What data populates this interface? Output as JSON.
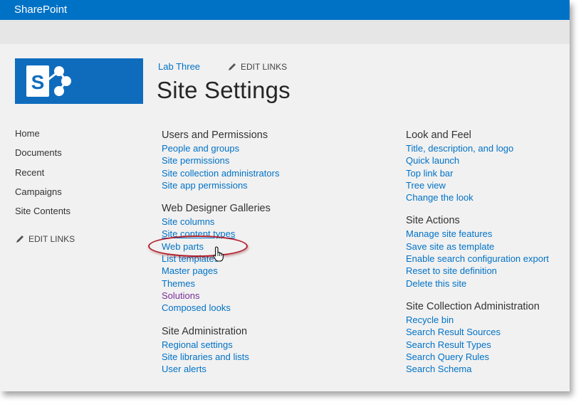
{
  "suitebar": {
    "brand": "SharePoint"
  },
  "header": {
    "breadcrumb": "Lab Three",
    "edit_links": "EDIT LINKS",
    "title": "Site Settings"
  },
  "quicklaunch": {
    "items": [
      "Home",
      "Documents",
      "Recent",
      "Campaigns",
      "Site Contents"
    ],
    "edit_links": "EDIT LINKS"
  },
  "users_permissions": {
    "title": "Users and Permissions",
    "links": [
      "People and groups",
      "Site permissions",
      "Site collection administrators",
      "Site app permissions"
    ]
  },
  "web_designer": {
    "title": "Web Designer Galleries",
    "links": [
      "Site columns",
      "Site content types",
      "Web parts",
      "List templates",
      "Master pages",
      "Themes",
      "Solutions",
      "Composed looks"
    ]
  },
  "site_admin": {
    "title": "Site Administration",
    "links": [
      "Regional settings",
      "Site libraries and lists",
      "User alerts"
    ]
  },
  "look_feel": {
    "title": "Look and Feel",
    "links": [
      "Title, description, and logo",
      "Quick launch",
      "Top link bar",
      "Tree view",
      "Change the look"
    ]
  },
  "site_actions": {
    "title": "Site Actions",
    "links": [
      "Manage site features",
      "Save site as template",
      "Enable search configuration export",
      "Reset to site definition",
      "Delete this site"
    ]
  },
  "site_collection_admin": {
    "title": "Site Collection Administration",
    "links": [
      "Recycle bin",
      "Search Result Sources",
      "Search Result Types",
      "Search Query Rules",
      "Search Schema"
    ]
  },
  "colors": {
    "suitebar": "#0072c6",
    "link": "#0072c6",
    "visited": "#7a2f99",
    "highlight": "#b11e2c"
  },
  "icons": [
    "sharepoint-logo-icon",
    "pencil-icon",
    "hand-cursor-icon"
  ]
}
